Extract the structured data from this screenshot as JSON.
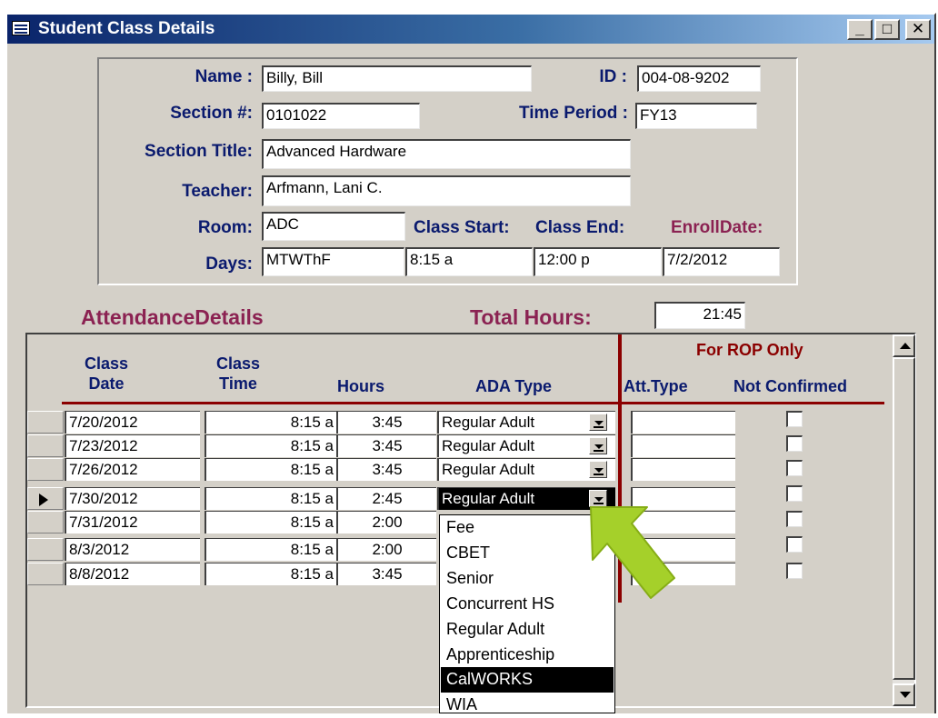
{
  "window": {
    "title": "Student Class Details",
    "minimize_glyph": "_",
    "maximize_glyph": "□",
    "close_glyph": "✕"
  },
  "student": {
    "name_label": "Name :",
    "name_value": "Billy, Bill",
    "id_label": "ID :",
    "id_value": "004-08-9202",
    "section_label": "Section #:",
    "section_value": "0101022",
    "time_period_label": "Time Period :",
    "time_period_value": "FY13",
    "section_title_label": "Section Title:",
    "section_title_value": "Advanced Hardware",
    "teacher_label": "Teacher:",
    "teacher_value": "Arfmann, Lani C.",
    "room_label": "Room:",
    "room_value": "ADC",
    "class_start_label": "Class Start:",
    "class_end_label": "Class End:",
    "enroll_date_label": "EnrollDate:",
    "days_label": "Days:",
    "days_value": "MTWThF",
    "class_start_value": "8:15 a",
    "class_end_value": "12:00 p",
    "enroll_date_value": "7/2/2012"
  },
  "attendance": {
    "section_label": "AttendanceDetails",
    "total_hours_label": "Total Hours:",
    "total_hours_value": "21:45",
    "rop_header": "For ROP Only",
    "columns": {
      "class_date": "Class Date",
      "class_time": "Class Time",
      "hours": "Hours",
      "ada_type": "ADA Type",
      "att_type": "Att.Type",
      "not_confirmed": "Not Confirmed"
    },
    "rows": [
      {
        "date": "7/20/2012",
        "time": "8:15 a",
        "hours": "3:45",
        "ada": "Regular Adult",
        "att": "",
        "current": false
      },
      {
        "date": "7/23/2012",
        "time": "8:15 a",
        "hours": "3:45",
        "ada": "Regular Adult",
        "att": "",
        "current": false
      },
      {
        "date": "7/26/2012",
        "time": "8:15 a",
        "hours": "3:45",
        "ada": "Regular Adult",
        "att": "",
        "current": false
      },
      {
        "date": "7/30/2012",
        "time": "8:15 a",
        "hours": "2:45",
        "ada": "Regular Adult",
        "att": "",
        "current": true
      },
      {
        "date": "7/31/2012",
        "time": "8:15 a",
        "hours": "2:00",
        "ada": "",
        "att": "",
        "current": false
      },
      {
        "date": "8/3/2012",
        "time": "8:15 a",
        "hours": "2:00",
        "ada": "",
        "att": "",
        "current": false
      },
      {
        "date": "8/8/2012",
        "time": "8:15 a",
        "hours": "3:45",
        "ada": "",
        "att": "",
        "current": false
      }
    ],
    "dropdown_options": [
      "Fee",
      "CBET",
      "Senior",
      "Concurrent HS",
      "Regular Adult",
      "Apprenticeship",
      "CalWORKS",
      "WIA"
    ],
    "dropdown_highlighted": "CalWORKS"
  },
  "colors": {
    "title_bar": "#0a246a",
    "label_blue": "#0a1a6e",
    "label_maroon": "#8b2252",
    "rop_red": "#8b0000",
    "arrow_green": "#a5d02a"
  },
  "icons": {
    "title_icon": "form-icon",
    "row_selector": "current-row-arrow-icon",
    "annotation": "green-pointer-arrow-icon"
  }
}
